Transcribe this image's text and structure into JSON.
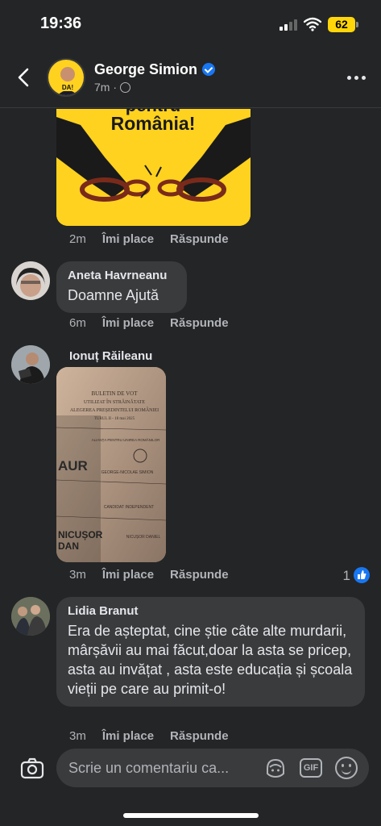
{
  "status_bar": {
    "time": "19:36",
    "battery": "62"
  },
  "header": {
    "name": "George Simion",
    "time": "7m",
    "sep": "·"
  },
  "post_image": {
    "line1": "pentru",
    "line2": "România!"
  },
  "comments": [
    {
      "time": "2m",
      "like": "Îmi place",
      "reply": "Răspunde"
    },
    {
      "author": "Aneta Havrneanu",
      "text": "Doamne Ajută",
      "time": "6m",
      "like": "Îmi place",
      "reply": "Răspunde"
    },
    {
      "author": "Ionuț Răileanu",
      "time": "3m",
      "like": "Îmi place",
      "reply": "Răspunde",
      "reactions": "1",
      "ballot": {
        "l1": "BULETIN DE VOT",
        "l2": "UTILIZAT ÎN STRĂINĂTATE",
        "l3": "ALEGEREA PREȘEDINTELUI ROMÂNIEI",
        "l4": "TURUL II - 18 mai 2025",
        "aur": "AUR",
        "alianta": "ALIANȚA PENTRU UNIREA ROMÂNILOR",
        "gs": "GEORGE-NICOLAE SIMION",
        "cand": "CANDIDAT INDEPENDENT",
        "nd1": "NICUȘOR",
        "nd2": "DAN",
        "nd_small": "NICUȘOR DANIEL"
      }
    },
    {
      "author": "Lidia Branut",
      "text": "Era de așteptat, cine știe câte alte murdarii, mârșăvii au mai făcut,doar la asta se pricep, asta au invățat , asta este educația și școala vieții pe care au primit-o!",
      "time": "3m",
      "like": "Îmi place",
      "reply": "Răspunde"
    }
  ],
  "composer": {
    "placeholder": "Scrie un comentariu ca...",
    "gif_label": "GIF"
  }
}
